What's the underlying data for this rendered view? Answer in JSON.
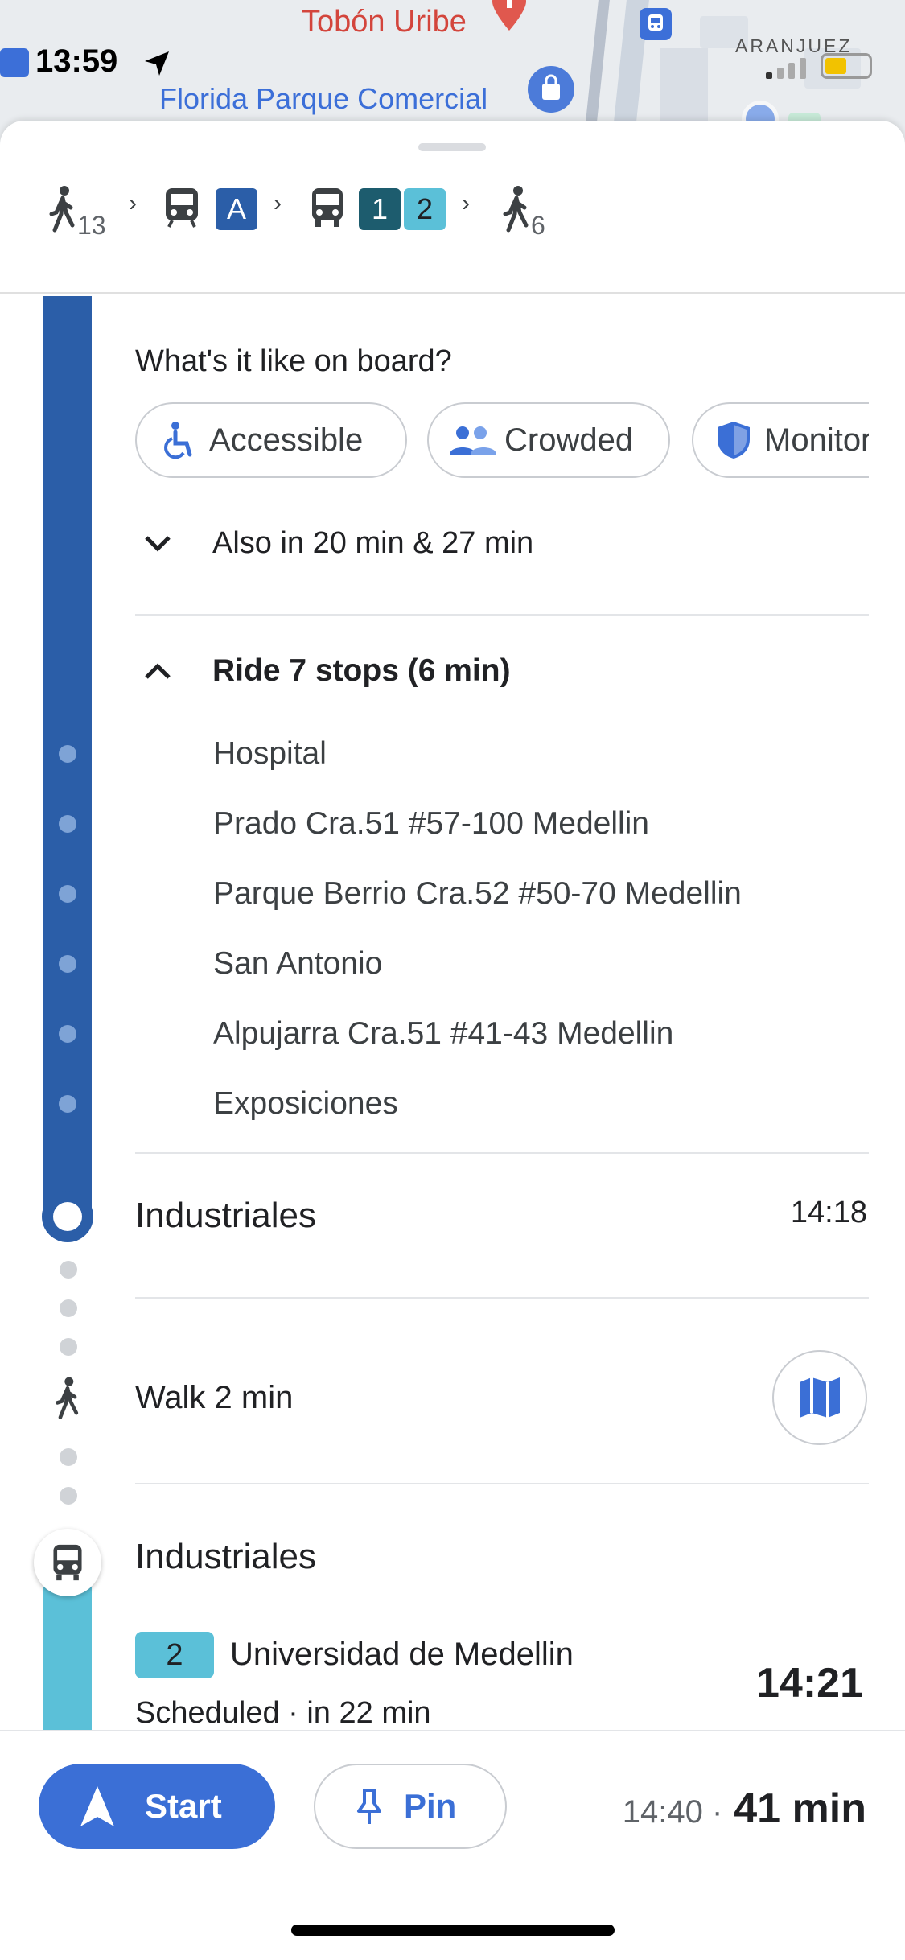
{
  "map": {
    "label_hospital": "Tobón Uribe",
    "label_mall": "Florida Parque Comercial",
    "label_neighborhood": "ARANJUEZ"
  },
  "status_bar": {
    "time": "13:59"
  },
  "summary": {
    "walk_start_min": "13",
    "route_a": "A",
    "route_1": "1",
    "route_2": "2",
    "walk_end_min": "6"
  },
  "onboard": {
    "question": "What's it like on board?",
    "chips": [
      "Accessible",
      "Crowded",
      "Monitored"
    ]
  },
  "also_in": "Also in 20 min & 27 min",
  "ride": {
    "label": "Ride 7 stops (6 min)",
    "stops": [
      "Hospital",
      "Prado Cra.51 #57-100 Medellin",
      "Parque Berrio Cra.52 #50-70 Medellin",
      "San Antonio",
      "Alpujarra Cra.51 #41-43 Medellin",
      "Exposiciones"
    ]
  },
  "arrival": {
    "station": "Industriales",
    "time": "14:18"
  },
  "walk": {
    "label": "Walk 2 min"
  },
  "next_leg": {
    "station": "Industriales",
    "route": "2",
    "destination": "Universidad de Medellin",
    "schedule": "Scheduled · in 22 min",
    "departure": "14:21"
  },
  "bottom_bar": {
    "start_label": "Start",
    "pin_label": "Pin",
    "arrival_time": "14:40 ·",
    "duration": "41 min"
  },
  "colors": {
    "metro_line_a": "#2b5ea8",
    "bus_route_1": "#1d5c6e",
    "bus_route_2": "#5bc0d8",
    "accent_blue": "#3b6fd6"
  }
}
